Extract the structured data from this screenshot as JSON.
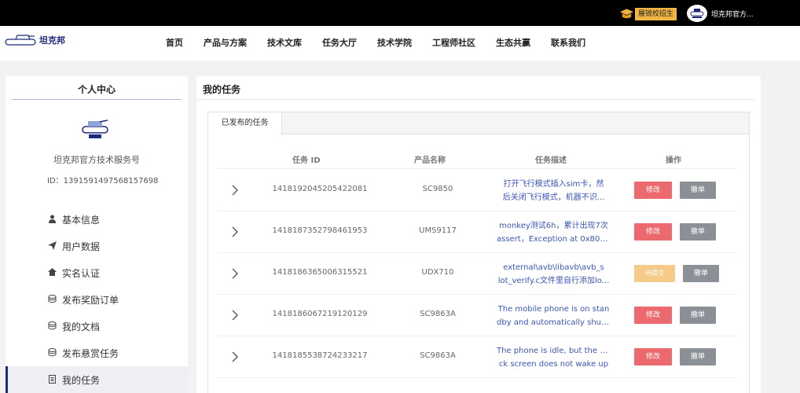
{
  "topbar": {
    "recruit_label": "展锐校招生",
    "user_name": "坦克邦官方..."
  },
  "nav": {
    "brand": "坦克邦",
    "links": [
      "首页",
      "产品与方案",
      "技术文库",
      "任务大厅",
      "技术学院",
      "工程师社区",
      "生态共赢",
      "联系我们"
    ]
  },
  "sidebar": {
    "title": "个人中心",
    "account_name": "坦克邦官方技术服务号",
    "account_id": "ID：1391591497568157698",
    "items": [
      {
        "label": "基本信息",
        "icon": "user-icon"
      },
      {
        "label": "用户数据",
        "icon": "send-icon"
      },
      {
        "label": "实名认证",
        "icon": "home-icon"
      },
      {
        "label": "发布奖励订单",
        "icon": "database-icon"
      },
      {
        "label": "我的文档",
        "icon": "database-icon"
      },
      {
        "label": "发布悬赏任务",
        "icon": "database-icon"
      },
      {
        "label": "我的任务",
        "icon": "document-icon"
      }
    ],
    "active_item": "我的任务"
  },
  "main": {
    "title": "我的任务",
    "tab": "已发布的任务",
    "columns": [
      "任务 ID",
      "产品名称",
      "任务描述",
      "操作"
    ],
    "rows": [
      {
        "id": "1418192045205422081",
        "product": "SC9850",
        "desc1": "打开飞行模式插入sim卡，然",
        "desc2": "后关闭飞行模式，机器不识...",
        "status_btn": "修改",
        "status_style": "red",
        "action_btn": "撤单"
      },
      {
        "id": "1418187352798461953",
        "product": "UMS9117",
        "desc1": "monkey测试6h，累计出现7次",
        "desc2": "assert，Exception at 0x80eff...",
        "status_btn": "修改",
        "status_style": "red",
        "action_btn": "撤单"
      },
      {
        "id": "1418186365006315521",
        "product": "UDX710",
        "desc1": "external\\avb\\libavb\\avb_s",
        "desc2": "lot_verify.c文件里自行添加lo...",
        "status_btn": "待提交",
        "status_style": "orange",
        "action_btn": "撤单"
      },
      {
        "id": "1418186067219120129",
        "product": "SC9863A",
        "desc1": "The mobile phone is on stan",
        "desc2": "dby and automatically shuts...",
        "status_btn": "修改",
        "status_style": "red",
        "action_btn": "撤单"
      },
      {
        "id": "1418185538724233217",
        "product": "SC9863A",
        "desc1": "The phone is idle, but the bla",
        "desc2": "ck screen does not wake up",
        "status_btn": "修改",
        "status_style": "red",
        "action_btn": "撤单"
      }
    ]
  },
  "colors": {
    "brand_navy": "#1f2a7c",
    "button_red": "#ec6a6e",
    "button_orange": "#f6ca88",
    "button_gray": "#8b8f96",
    "link_blue": "#3a55b8"
  }
}
